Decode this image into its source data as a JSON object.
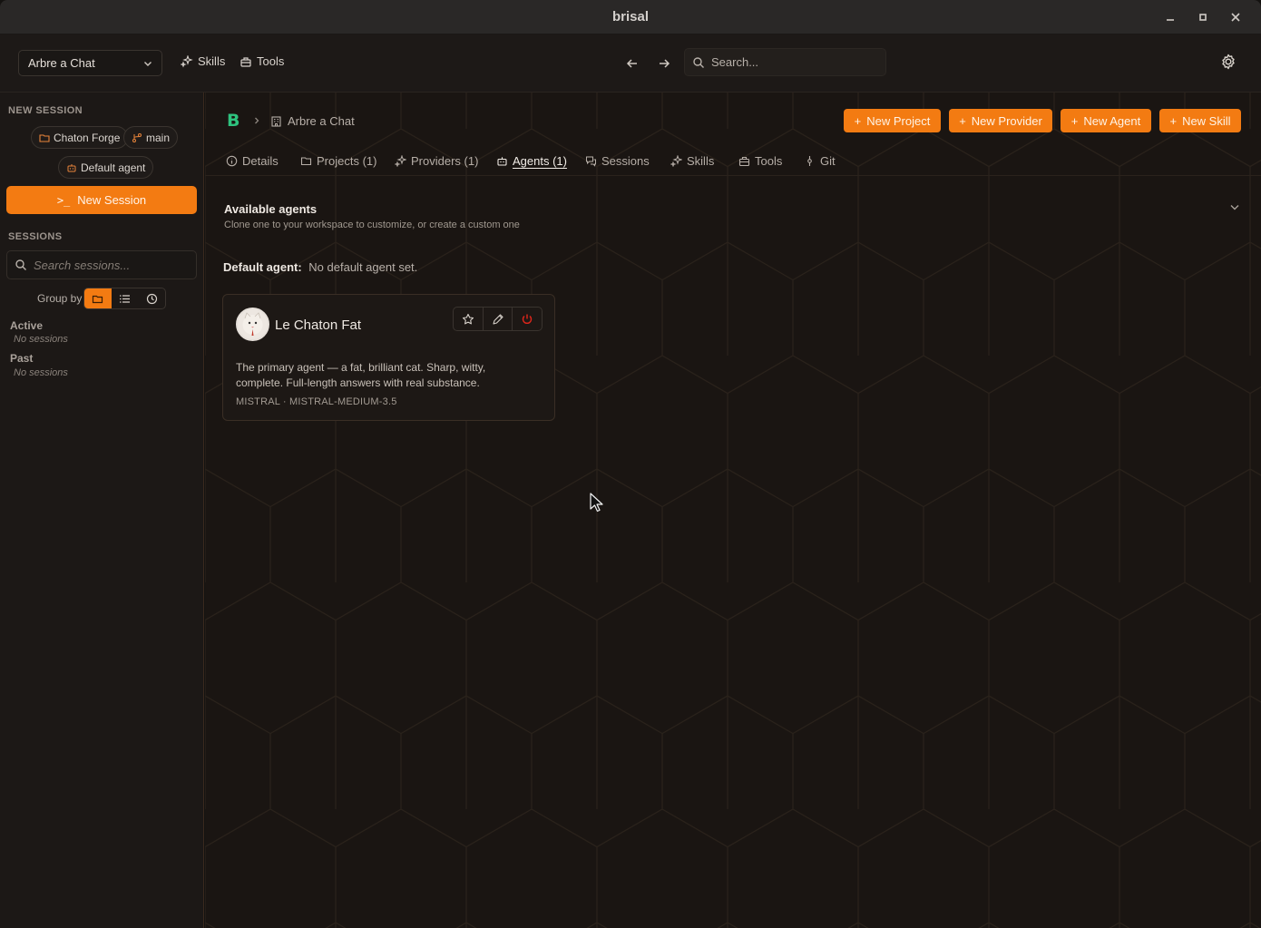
{
  "window": {
    "title": "brisal"
  },
  "toolbar": {
    "project_select": "Arbre a Chat",
    "skills_label": "Skills",
    "tools_label": "Tools",
    "search_placeholder": "Search..."
  },
  "sidebar": {
    "new_session_heading": "NEW SESSION",
    "chip_project": "Chaton Forge",
    "chip_branch": "main",
    "chip_agent": "Default agent",
    "new_session_button": "New Session",
    "sessions_heading": "SESSIONS",
    "search_placeholder": "Search sessions...",
    "group_by_label": "Group by",
    "groups": [
      {
        "title": "Active",
        "empty": "No sessions"
      },
      {
        "title": "Past",
        "empty": "No sessions"
      }
    ]
  },
  "main": {
    "breadcrumb_logo": "B",
    "breadcrumb_project": "Arbre a Chat",
    "actions": {
      "new_project": "New Project",
      "new_provider": "New Provider",
      "new_agent": "New Agent",
      "new_skill": "New Skill"
    },
    "tabs": [
      {
        "label": "Details",
        "icon": "info-icon"
      },
      {
        "label": "Projects (1)",
        "icon": "folder-icon"
      },
      {
        "label": "Providers (1)",
        "icon": "sparkle-icon"
      },
      {
        "label": "Agents (1)",
        "icon": "robot-icon",
        "active": true
      },
      {
        "label": "Sessions",
        "icon": "chat-icon"
      },
      {
        "label": "Skills",
        "icon": "sparkle-icon"
      },
      {
        "label": "Tools",
        "icon": "toolbox-icon"
      },
      {
        "label": "Git",
        "icon": "git-commit-icon"
      }
    ],
    "available_title": "Available agents",
    "available_subtitle": "Clone one to your workspace to customize, or create a custom one",
    "default_agent_label": "Default agent:",
    "default_agent_value": "No default agent set.",
    "agent_card": {
      "name": "Le Chaton Fat",
      "description": "The primary agent — a fat, brilliant cat. Sharp, witty, complete. Full-length answers with real substance.",
      "model": "MISTRAL · MISTRAL-MEDIUM-3.5"
    }
  },
  "colors": {
    "accent": "#f37b12",
    "danger": "#e0261b",
    "logo": "#2ec27e"
  }
}
